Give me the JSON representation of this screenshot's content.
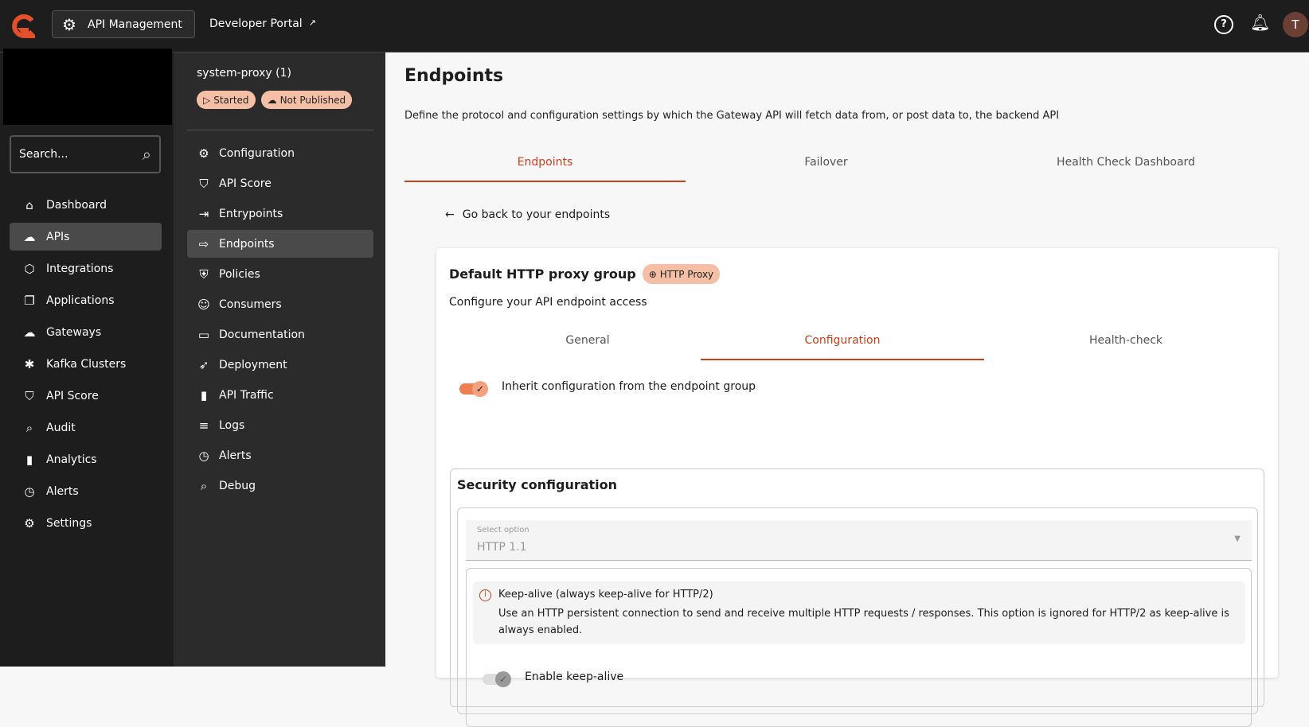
{
  "topbar": {
    "app_switcher": "API Management",
    "developer_portal": "Developer Portal",
    "avatar_initial": "T"
  },
  "sidebar": {
    "search_placeholder": "Search...",
    "items": [
      {
        "label": "Dashboard",
        "icon": "home-icon"
      },
      {
        "label": "APIs",
        "icon": "cloud-api-icon"
      },
      {
        "label": "Integrations",
        "icon": "cube-icon"
      },
      {
        "label": "Applications",
        "icon": "apps-icon"
      },
      {
        "label": "Gateways",
        "icon": "cloud-icon"
      },
      {
        "label": "Kafka Clusters",
        "icon": "cluster-icon"
      },
      {
        "label": "API Score",
        "icon": "shield-check-icon"
      },
      {
        "label": "Audit",
        "icon": "audit-icon"
      },
      {
        "label": "Analytics",
        "icon": "bar-chart-icon"
      },
      {
        "label": "Alerts",
        "icon": "alarm-icon"
      },
      {
        "label": "Settings",
        "icon": "gear-icon"
      }
    ]
  },
  "api": {
    "name": "system-proxy (1)",
    "status": "Started",
    "publish": "Not Published",
    "menu": [
      {
        "label": "Configuration",
        "icon": "⚙"
      },
      {
        "label": "API Score",
        "icon": "⛉"
      },
      {
        "label": "Entrypoints",
        "icon": "⇥"
      },
      {
        "label": "Endpoints",
        "icon": "⇨"
      },
      {
        "label": "Policies",
        "icon": "⛨"
      },
      {
        "label": "Consumers",
        "icon": "☺"
      },
      {
        "label": "Documentation",
        "icon": "▭"
      },
      {
        "label": "Deployment",
        "icon": "➶"
      },
      {
        "label": "API Traffic",
        "icon": "▮"
      },
      {
        "label": "Logs",
        "icon": "≡"
      },
      {
        "label": "Alerts",
        "icon": "◷"
      },
      {
        "label": "Debug",
        "icon": "⌕"
      }
    ]
  },
  "main": {
    "title": "Endpoints",
    "description": "Define the protocol and configuration settings by which the Gateway API will fetch data from, or post data to, the backend API",
    "tabs": [
      "Endpoints",
      "Failover",
      "Health Check Dashboard"
    ],
    "back": "Go back to your endpoints",
    "card": {
      "title": "Default HTTP proxy group",
      "badge": "HTTP Proxy",
      "subtitle": "Configure your API endpoint access",
      "tabs": [
        "General",
        "Configuration",
        "Health-check"
      ],
      "inherit_label": "Inherit configuration from the endpoint group",
      "security_title": "Security configuration",
      "select_label": "Select option",
      "select_value": "HTTP 1.1",
      "info_title": "Keep-alive (always keep-alive for HTTP/2)",
      "info_text": "Use an HTTP persistent connection to send and receive multiple HTTP requests / responses. This option is ignored for HTTP/2 as keep-alive is always enabled.",
      "keepalive_label": "Enable keep-alive"
    }
  },
  "colors": {
    "accent": "#c8401a",
    "badge": "#f4bfa5",
    "toggle": "#ee7f50"
  }
}
